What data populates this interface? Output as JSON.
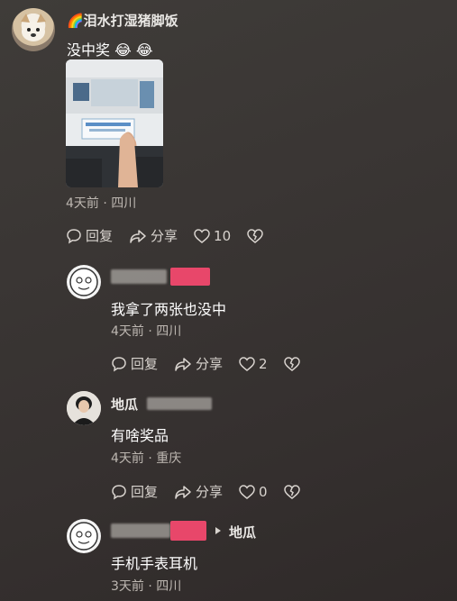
{
  "main_comment": {
    "username": "🌈泪水打湿猪脚饭",
    "text": "没中奖 😂 😂",
    "meta": "4天前 · 四川",
    "actions": {
      "reply": "回复",
      "share": "分享",
      "likes": "10"
    }
  },
  "replies": [
    {
      "username": "",
      "text": "我拿了两张也没中",
      "meta": "4天前 · 四川",
      "actions": {
        "reply": "回复",
        "share": "分享",
        "likes": "2"
      }
    },
    {
      "username": "地瓜",
      "text": "有啥奖品",
      "meta": "4天前 · 重庆",
      "actions": {
        "reply": "回复",
        "share": "分享",
        "likes": "0"
      }
    },
    {
      "username": "",
      "reply_to": "地瓜",
      "text": "手机手表耳机",
      "meta": "3天前 · 四川"
    }
  ],
  "icons": [
    "heart-icon",
    "broken-heart-icon",
    "reply-icon",
    "share-icon",
    "triangle-right-icon"
  ],
  "colors": {
    "accent_pink": "#e8476a",
    "meta_gray": "#bdb7b1"
  }
}
